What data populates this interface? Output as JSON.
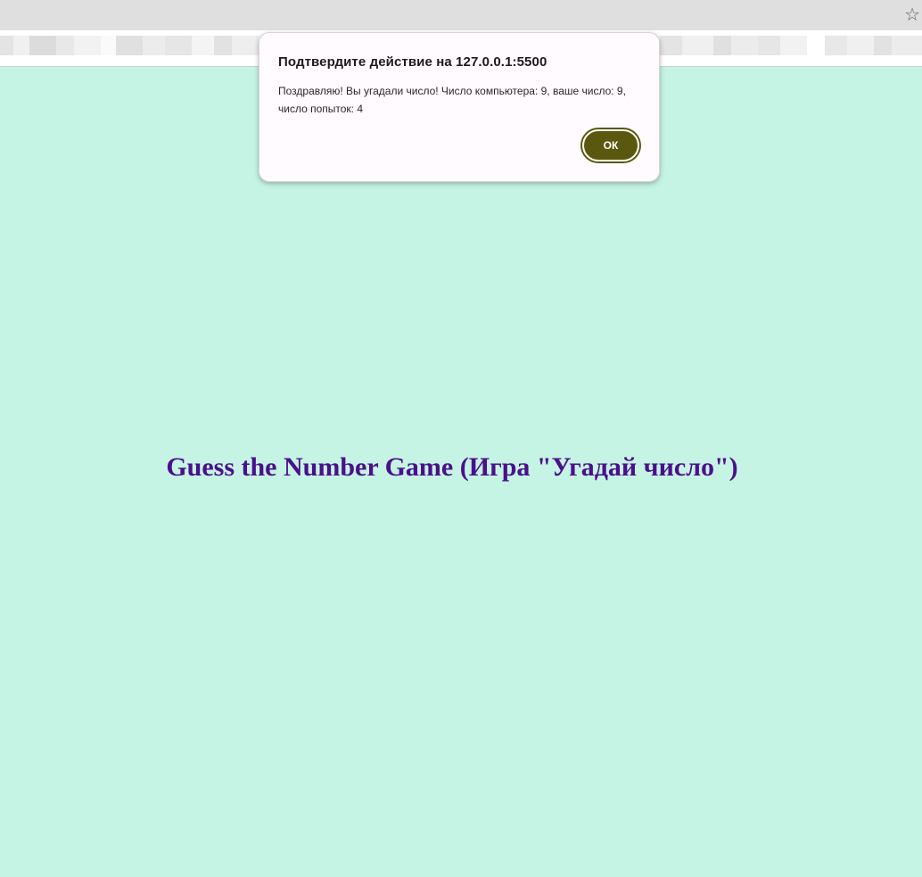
{
  "browser": {
    "bookmark_star_icon": "star-outline-icon"
  },
  "dialog": {
    "title": "Подтвердите действие на 127.0.0.1:5500",
    "message": "Поздравляю! Вы угадали число! Число компьютера: 9, ваше число: 9, число попыток: 4",
    "ok_label": "ОК"
  },
  "page": {
    "heading": "Guess the Number Game (Игра \"Угадай число\")"
  },
  "colors": {
    "background": "#c6f4e4",
    "heading": "#4b0f8c",
    "ok_button": "#5a580e",
    "dialog_bg": "#fffbfe"
  }
}
